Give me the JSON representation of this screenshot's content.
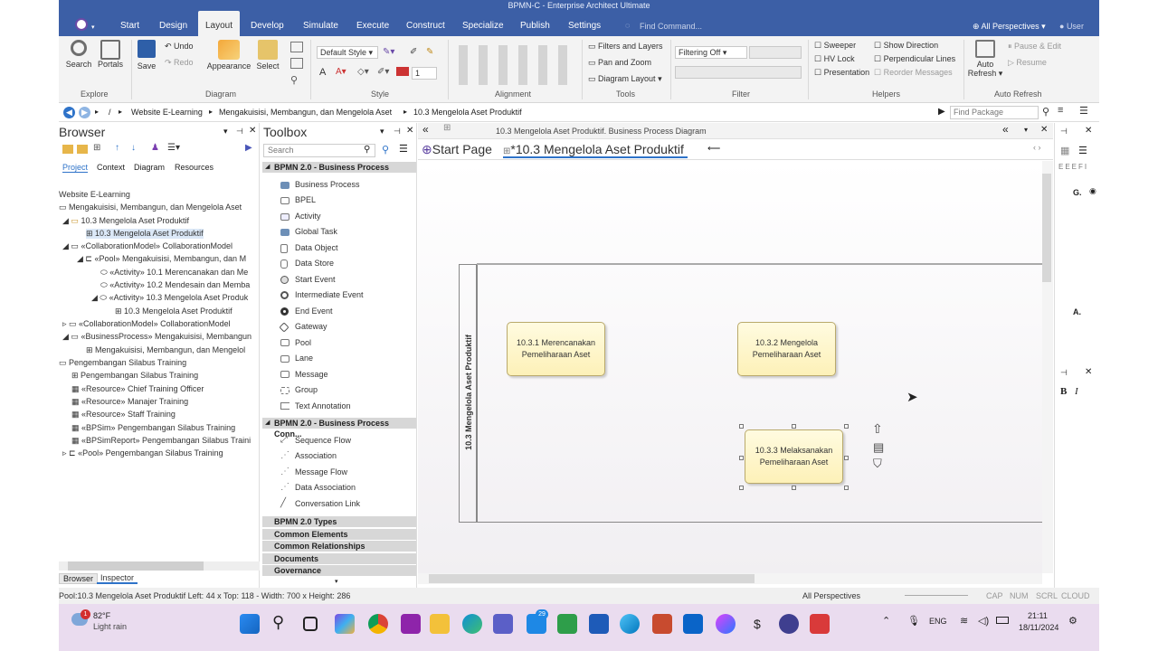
{
  "window": {
    "title": "BPMN-C - Enterprise Architect Ultimate"
  },
  "menu": {
    "items": [
      "Start",
      "Design",
      "Layout",
      "Develop",
      "Simulate",
      "Execute",
      "Construct",
      "Specialize",
      "Publish",
      "Settings"
    ],
    "find_placeholder": "Find Command...",
    "perspectives": "All Perspectives",
    "user": "User"
  },
  "ribbon": {
    "explore": {
      "label": "Explore",
      "search": "Search",
      "portals": "Portals"
    },
    "diagram": {
      "label": "Diagram",
      "save": "Save",
      "undo": "Undo",
      "redo": "Redo",
      "appearance": "Appearance",
      "select": "Select"
    },
    "style": {
      "label": "Style",
      "default_style": "Default Style",
      "line_width": "1"
    },
    "alignment": {
      "label": "Alignment"
    },
    "tools": {
      "label": "Tools",
      "filters_layers": "Filters and Layers",
      "pan_zoom": "Pan and Zoom",
      "diagram_layout": "Diagram Layout"
    },
    "filter": {
      "label": "Filter",
      "filtering": "Filtering Off"
    },
    "helpers": {
      "label": "Helpers",
      "sweeper": "Sweeper",
      "hv_lock": "HV Lock",
      "presentation": "Presentation",
      "show_direction": "Show Direction",
      "perpendicular": "Perpendicular Lines",
      "reorder": "Reorder Messages"
    },
    "auto_refresh": {
      "label": "Auto Refresh",
      "button": "Auto Refresh",
      "pause_edit": "Pause & Edit",
      "resume": "Resume"
    }
  },
  "breadcrumb": {
    "items": [
      "/",
      "Website E-Learning",
      "Mengakuisisi, Membangun, dan Mengelola Aset",
      "10.3 Mengelola Aset Produktif"
    ],
    "find_package_placeholder": "Find Package"
  },
  "browser": {
    "title": "Browser",
    "tabs": [
      "Project",
      "Context",
      "Diagram",
      "Resources"
    ],
    "tree": [
      "Website E-Learning",
      "Mengakuisisi, Membangun, dan Mengelola Aset",
      "10.3 Mengelola Aset Produktif",
      "10.3 Mengelola Aset Produktif",
      "«CollaborationModel» CollaborationModel",
      "«Pool» Mengakuisisi, Membangun, dan M",
      "«Activity» 10.1 Merencanakan dan Me",
      "«Activity» 10.2 Mendesain dan Memba",
      "«Activity» 10.3 Mengelola Aset Produk",
      "10.3 Mengelola Aset Produktif",
      "«CollaborationModel» CollaborationModel",
      "«BusinessProcess» Mengakuisisi, Membangun",
      "Mengakuisisi, Membangun, dan Mengelol",
      "Pengembangan Silabus Training",
      "Pengembangan Silabus Training",
      "«Resource» Chief Training Officer",
      "«Resource» Manajer Training",
      "«Resource» Staff Training",
      "«BPSim» Pengembangan Silabus Training",
      "«BPSimReport» Pengembangan Silabus Traini",
      "«Pool» Pengembangan Silabus Training"
    ],
    "bottom_tabs": [
      "Browser",
      "Inspector"
    ]
  },
  "toolbox": {
    "title": "Toolbox",
    "search_placeholder": "Search",
    "section1": "BPMN 2.0 - Business Process",
    "items1": [
      "Business Process",
      "BPEL",
      "Activity",
      "Global Task",
      "Data Object",
      "Data Store",
      "Start Event",
      "Intermediate Event",
      "End Event",
      "Gateway",
      "Pool",
      "Lane",
      "Message",
      "Group",
      "Text Annotation"
    ],
    "section2": "BPMN 2.0 - Business Process Conn...",
    "items2": [
      "Sequence Flow",
      "Association",
      "Message Flow",
      "Data Association",
      "Conversation Link"
    ],
    "collapsed": [
      "BPMN 2.0 Types",
      "Common Elements",
      "Common Relationships",
      "Documents",
      "Governance"
    ]
  },
  "diagram": {
    "header": "10.3 Mengelola Aset Produktif.  Business Process Diagram",
    "tabs": [
      "Start Page",
      "*10.3 Mengelola Aset Produktif"
    ],
    "pool_label": "10.3 Mengelola Aset Produktif",
    "tasks": [
      "10.3.1 Merencanakan Pemeliharaan Aset",
      "10.3.2 Mengelola Pemeliharaan Aset",
      "10.3.3 Melaksanakan Pemeliharaan Aset"
    ]
  },
  "right_panel": {
    "g_label": "G.",
    "a_label": "A.",
    "bold": "B",
    "italic": "I"
  },
  "status": {
    "selection": "Pool:10.3 Mengelola Aset Produktif   Left:   44 x Top:   118 - Width:   700 x Height:   286",
    "perspectives": "All Perspectives",
    "indicators": [
      "CAP",
      "NUM",
      "SCRL",
      "CLOUD"
    ]
  },
  "taskbar": {
    "weather_temp": "82°F",
    "weather_desc": "Light rain",
    "weather_badge": "1",
    "teams_badge": "29",
    "lang": "ENG",
    "time": "21:11",
    "date": "18/11/2024"
  },
  "colors": {
    "titlebar": "#3c5fa6",
    "ribbon": "#f3f3f3",
    "task_fill": "#fdf1b8",
    "taskbar": "#eadcef"
  }
}
